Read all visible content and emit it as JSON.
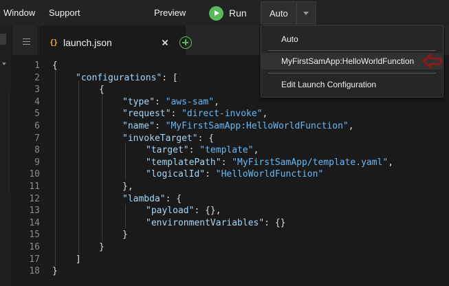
{
  "menubar": {
    "window": "Window",
    "support": "Support",
    "preview": "Preview",
    "run": "Run",
    "config_selected": "Auto"
  },
  "tab": {
    "icon_text": "{}",
    "label": "launch.json",
    "icon": "json-file-icon"
  },
  "dropdown": {
    "items": [
      {
        "label": "Auto"
      },
      {
        "label": "MyFirstSamApp:HelloWorldFunction"
      },
      {
        "label": "Edit Launch Configuration"
      }
    ]
  },
  "editor": {
    "line_numbers": [
      "1",
      "2",
      "3",
      "4",
      "5",
      "6",
      "7",
      "8",
      "9",
      "10",
      "11",
      "12",
      "13",
      "14",
      "15",
      "16",
      "17",
      "18"
    ],
    "lines": [
      "{",
      "\"configurations\": [",
      "{",
      "\"type\": \"aws-sam\",",
      "\"request\": \"direct-invoke\",",
      "\"name\": \"MyFirstSamApp:HelloWorldFunction\",",
      "\"invokeTarget\": {",
      "\"target\": \"template\",",
      "\"templatePath\": \"MyFirstSamApp/template.yaml\",",
      "\"logicalId\": \"HelloWorldFunction\"",
      "},",
      "\"lambda\": {",
      "\"payload\": {},",
      "\"environmentVariables\": {}",
      "}",
      "}",
      "]",
      "}"
    ]
  },
  "colors": {
    "background": "#1a1a1a",
    "run_green": "#5cb85c",
    "key_color": "#a6d6f5",
    "string_color": "#69b9f5",
    "arrow": "#8b1a1a"
  }
}
